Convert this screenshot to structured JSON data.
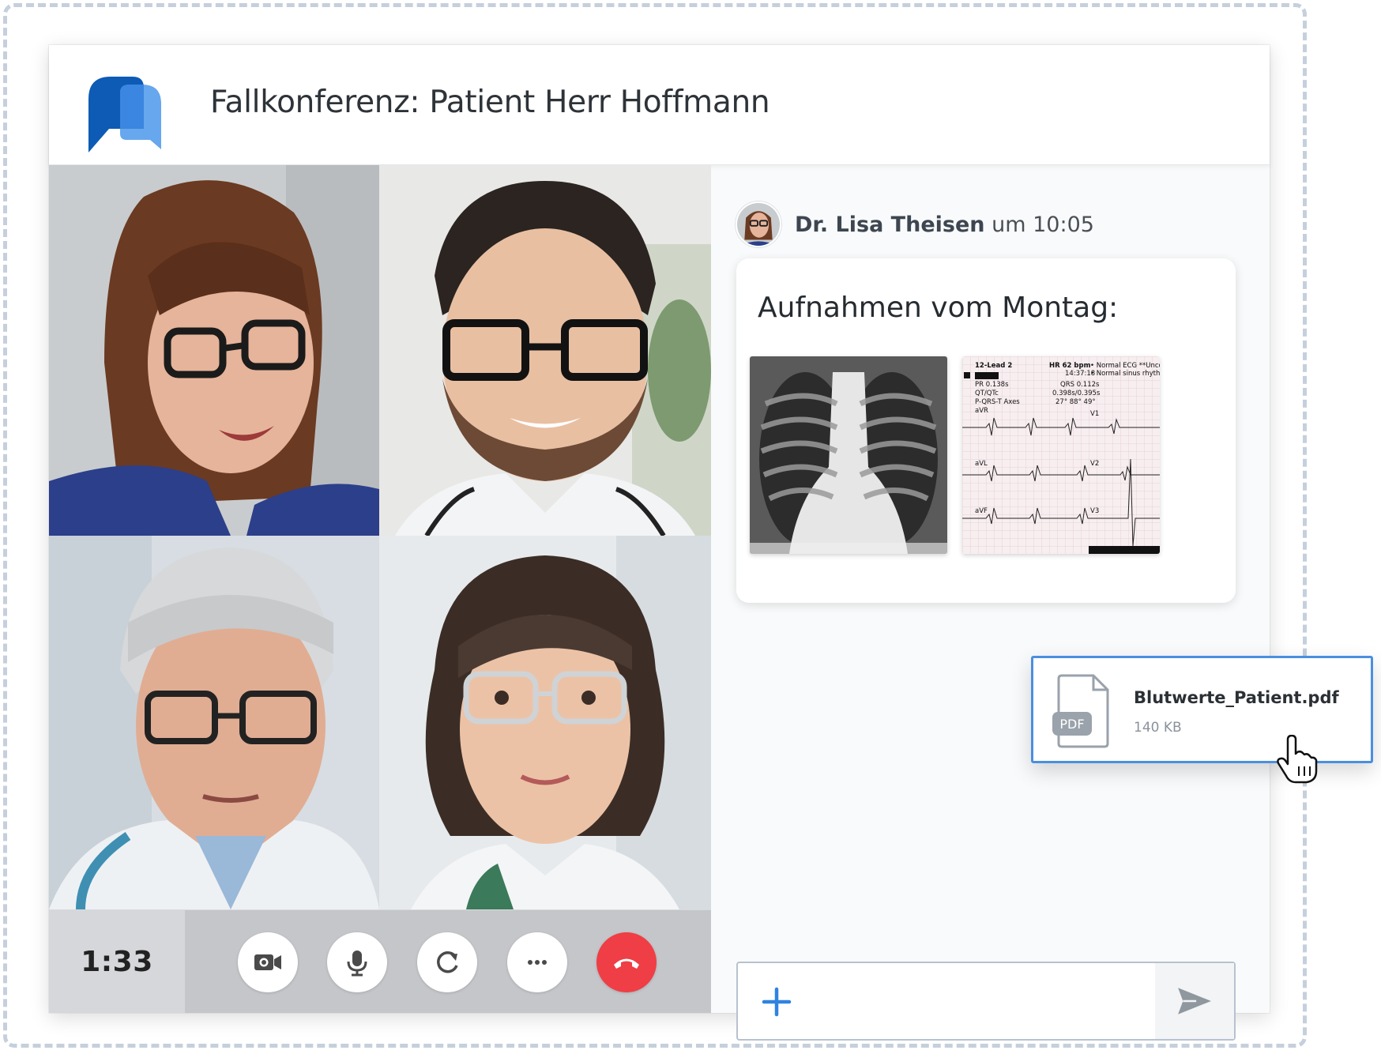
{
  "header": {
    "title": "Fallkonferenz: Patient Herr Hoffmann"
  },
  "call": {
    "timer": "1:33"
  },
  "controls": [
    "camera-icon",
    "microphone-icon",
    "rotate-icon",
    "more-icon",
    "hang-up-icon"
  ],
  "chat": {
    "message": {
      "sender": "Dr. Lisa Theisen",
      "time_prefix": "um",
      "time": "10:05",
      "text": "Aufnahmen vom Montag:",
      "attachments": [
        "chest-xray-image",
        "ecg-image"
      ]
    },
    "input": {
      "add_icon": "plus-icon",
      "send_icon": "send-icon"
    }
  },
  "file_card": {
    "type_label": "PDF",
    "name": "Blutwerte_Patient.pdf",
    "size": "140 KB"
  },
  "ecg_labels": {
    "title": "12-Lead 2",
    "hr": "HR 62 bpm",
    "finding": "• Normal ECG **Unco",
    "rhythm": "• Normal sinus rhythm",
    "pr": "PR 0.138s",
    "qt": "QT/QTc",
    "pqrst": "P-QRS-T Axes",
    "time": "14:37:18",
    "qrs": "QRS 0.112s",
    "qtc": "0.398s/0.395s",
    "axes": "27° 88° 49°",
    "lead_avr": "aVR",
    "lead_avl": "aVL",
    "lead_avf": "aVF",
    "lead_v1": "V1",
    "lead_v2": "V2",
    "lead_v3": "V3"
  },
  "colors": {
    "accent": "#4a8fe0",
    "hangup": "#ef3e45",
    "logo_dark": "#0d5bb5",
    "logo_light": "#5aa0ec"
  }
}
